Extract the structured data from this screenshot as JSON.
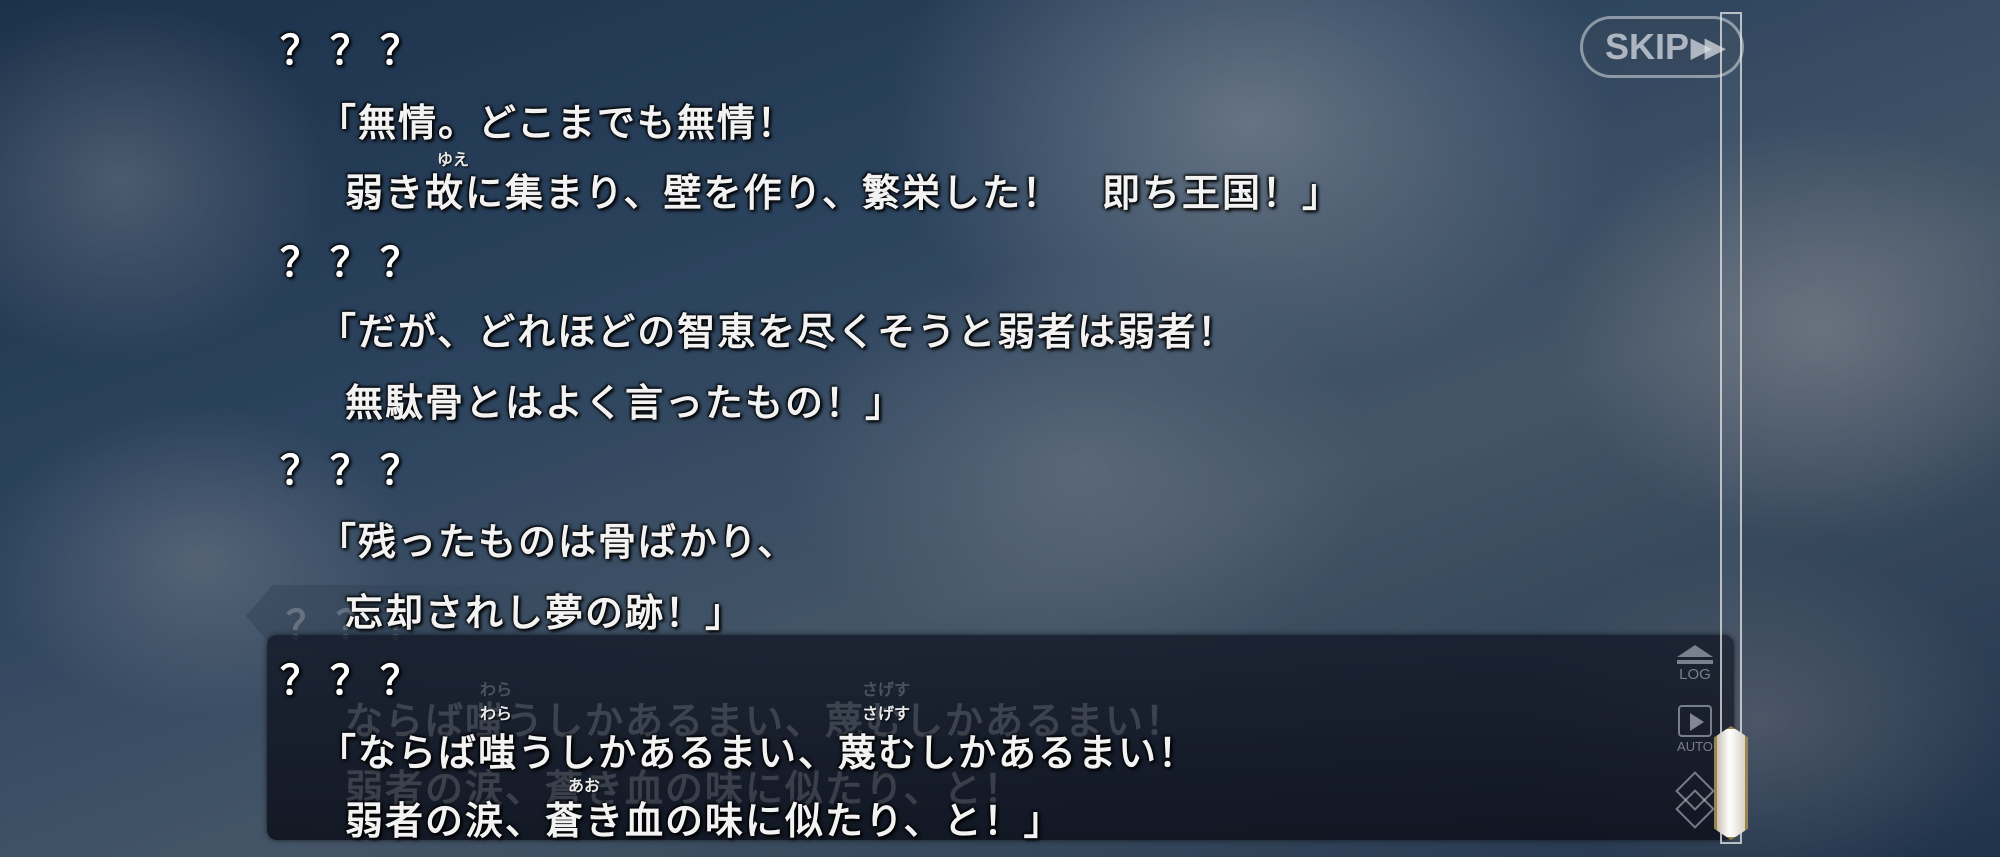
{
  "controls": {
    "skip_label": "SKIP",
    "skip_icon": "fast-forward-icon",
    "log_label": "LOG",
    "auto_label": "AUTO",
    "menu_icon": "diamond-menu-icon"
  },
  "backlog": [
    {
      "speaker": "？？？",
      "lines": [
        "「無情。どこまでも無情！",
        "弱き故に集まり、壁を作り、繁栄した！　即ち王国！」"
      ],
      "rubies": [
        {
          "text": "ゆえ",
          "line": 1
        }
      ]
    },
    {
      "speaker": "？？？",
      "lines": [
        "「だが、どれほどの智恵を尽くそうと弱者は弱者！",
        "無駄骨とはよく言ったもの！」"
      ],
      "rubies": []
    },
    {
      "speaker": "？？？",
      "lines": [
        "「残ったものは骨ばかり、",
        "忘却されし夢の跡！」"
      ],
      "rubies": []
    }
  ],
  "current": {
    "speaker": "？？？",
    "lines": [
      "「ならば嗤うしかあるまい、蔑むしかあるまい！",
      "弱者の涙、蒼き血の味に似たり、と！」"
    ],
    "rubies": [
      "わら",
      "さげす",
      "あお"
    ]
  },
  "ghost": {
    "speaker": "？？？",
    "lines": [
      "ならば嗤うしかあるまい、蔑むしかあるまい！",
      "弱者の涙、蒼き血の味に似たり、と！"
    ],
    "rubies": [
      "わら",
      "さげす"
    ]
  }
}
